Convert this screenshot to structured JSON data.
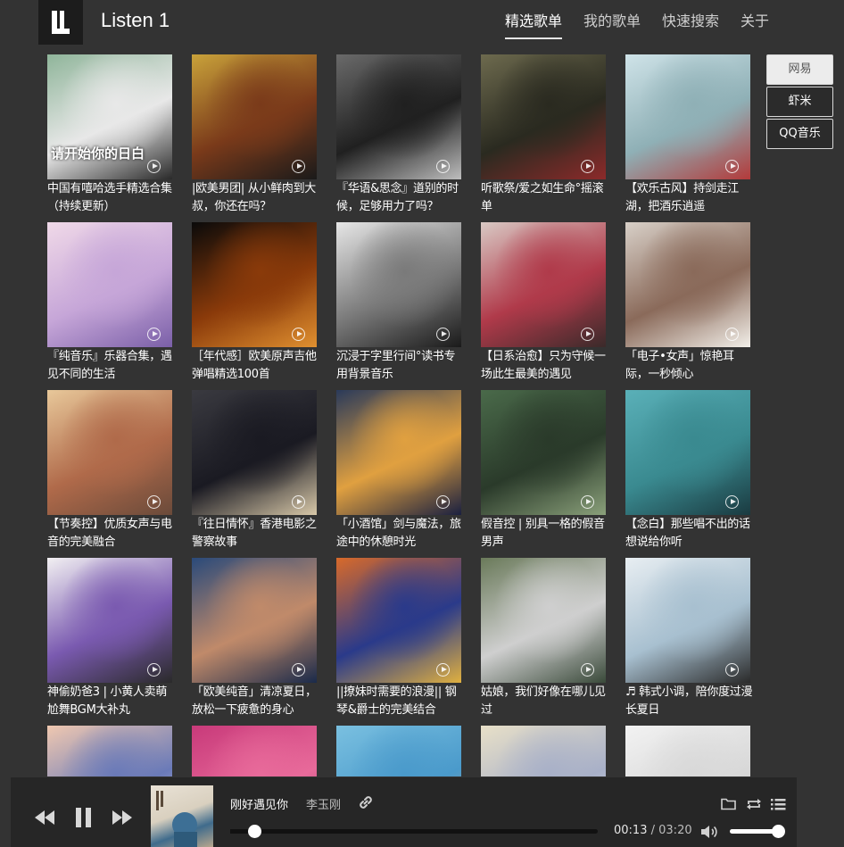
{
  "app": {
    "title": "Listen 1"
  },
  "nav": {
    "tabs": [
      {
        "label": "精选歌单",
        "active": true
      },
      {
        "label": "我的歌单",
        "active": false
      },
      {
        "label": "快速搜索",
        "active": false
      },
      {
        "label": "关于",
        "active": false
      }
    ]
  },
  "sources": [
    {
      "label": "网易",
      "active": true
    },
    {
      "label": "虾米",
      "active": false
    },
    {
      "label": "QQ音乐",
      "active": false
    }
  ],
  "playlists": [
    {
      "title": "中国有嘻哈选手精选合集（持续更新）",
      "cover_text": "请开始你的日白",
      "colors": [
        "#8fb59a",
        "#e8e8e8",
        "#2a2a2a"
      ]
    },
    {
      "title": "|欧美男团| 从小鲜肉到大叔，你还在吗？",
      "colors": [
        "#c9a23a",
        "#7a3a1a",
        "#1a1a1a"
      ]
    },
    {
      "title": "『华语&思念』道别的时候，足够用力了吗？",
      "colors": [
        "#6a6a6a",
        "#202020",
        "#bdbdbd"
      ]
    },
    {
      "title": "听歌祭/爱之如生命°摇滚单",
      "colors": [
        "#6d6a4e",
        "#2a2a20",
        "#8c2a2a"
      ]
    },
    {
      "title": "【欢乐古风】持剑走江湖，把酒乐逍遥",
      "colors": [
        "#cfe3e8",
        "#8fb0b6",
        "#b33a3a"
      ]
    },
    {
      "title": "『纯音乐』乐器合集，遇见不同的生活",
      "colors": [
        "#f0d9e8",
        "#c6a6d8",
        "#7a5fa8"
      ]
    },
    {
      "title": "［年代感］欧美原声吉他弹唱精选100首",
      "colors": [
        "#0a0a0a",
        "#8a3a0a",
        "#e09030"
      ]
    },
    {
      "title": "沉浸于字里行间°读书专用背景音乐",
      "colors": [
        "#e6e6e6",
        "#7a7a7a",
        "#1a1a1a"
      ]
    },
    {
      "title": "【日系治愈】只为守候一场此生最美的遇见",
      "colors": [
        "#d9c9c4",
        "#b03a4a",
        "#3a2a2a"
      ]
    },
    {
      "title": "「电子•女声」惊艳耳际，一秒倾心",
      "colors": [
        "#d8d0c8",
        "#8a6a5a",
        "#f2efe9"
      ]
    },
    {
      "title": "【节奏控】优质女声与电音的完美融合",
      "colors": [
        "#e8c89a",
        "#b06a4a",
        "#6a4a3a"
      ]
    },
    {
      "title": "『往日情怀』香港电影之警察故事",
      "colors": [
        "#3a3a40",
        "#1a1a22",
        "#d8c8a8"
      ]
    },
    {
      "title": "「小酒馆」剑与魔法，旅途中的休憩时光",
      "colors": [
        "#2a3a5a",
        "#e0a040",
        "#1a2040"
      ]
    },
    {
      "title": "假音控 | 别具一格的假音男声",
      "colors": [
        "#4a6a4a",
        "#2a3a2a",
        "#8aa07a"
      ]
    },
    {
      "title": "【念白】那些唱不出的话想说给你听",
      "colors": [
        "#5ab0b8",
        "#3a8a90",
        "#1a3a40"
      ]
    },
    {
      "title": "神偷奶爸3 | 小黄人卖萌尬舞BGM大补丸",
      "colors": [
        "#f2f0f2",
        "#7a5ab0",
        "#2a2a2a"
      ]
    },
    {
      "title": "「欧美纯音」清凉夏日，放松一下疲惫的身心",
      "colors": [
        "#2a4a7a",
        "#c08a6a",
        "#1a2a4a"
      ]
    },
    {
      "title": "||撩妹时需要的浪漫|| 钢琴&爵士的完美结合",
      "colors": [
        "#d86a2a",
        "#2a3a8a",
        "#e0b040"
      ]
    },
    {
      "title": "姑娘，我们好像在哪儿见过",
      "colors": [
        "#6a7a5a",
        "#cfcfcf",
        "#3a4a3a"
      ]
    },
    {
      "title": "♬ 韩式小调，陪你度过漫长夏日",
      "colors": [
        "#e8eef2",
        "#a8c0d0",
        "#2a2a2a"
      ]
    },
    {
      "title": "",
      "colors": [
        "#f0c8b0",
        "#6a7ab8",
        "#e8d8f0"
      ]
    },
    {
      "title": "",
      "colors": [
        "#c83a7a",
        "#e86a9a",
        "#7a2a5a"
      ]
    },
    {
      "title": "",
      "colors": [
        "#7ac0e0",
        "#4a9acb",
        "#c8a07a"
      ]
    },
    {
      "title": "",
      "colors": [
        "#e8e0c8",
        "#a8b0c8",
        "#f2f2f2"
      ]
    },
    {
      "title": "",
      "colors": [
        "#f2f2f2",
        "#d8d8d8",
        "#c0c0c0"
      ]
    }
  ],
  "player": {
    "track_title": "刚好遇见你",
    "artist": "李玉刚",
    "current_time": "00:13",
    "time_separator": "/",
    "total_time": "03:20",
    "progress_fraction": 0.065,
    "volume_fraction": 0.9,
    "icons": {
      "prev": "previous-icon",
      "pause": "pause-icon",
      "next": "next-icon",
      "link": "link-icon",
      "folder": "folder-icon",
      "repeat": "repeat-icon",
      "list": "playlist-icon",
      "volume": "volume-icon"
    }
  }
}
